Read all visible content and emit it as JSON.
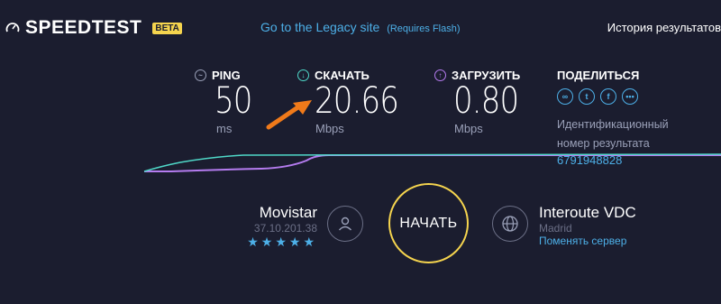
{
  "header": {
    "logo_text": "SPEEDTEST",
    "beta_badge": "BETA",
    "legacy_link": "Go to the Legacy site",
    "legacy_note": "(Requires Flash)",
    "history_link": "История результатов"
  },
  "metrics": {
    "ping": {
      "label": "PING",
      "value": "50",
      "unit": "ms"
    },
    "download": {
      "label": "СКАЧАТЬ",
      "value": "20.66",
      "unit": "Mbps"
    },
    "upload": {
      "label": "ЗАГРУЗИТЬ",
      "value": "0.80",
      "unit": "Mbps"
    }
  },
  "share": {
    "label": "ПОДЕЛИТЬСЯ",
    "result_label_line1": "Идентификационный",
    "result_label_line2": "номер результата",
    "result_id": "6791948828"
  },
  "isp": {
    "name": "Movistar",
    "ip": "37.10.201.38",
    "stars": "★★★★★",
    "rating": 5
  },
  "go_button": {
    "label": "НАЧАТЬ"
  },
  "server": {
    "name": "Interoute VDC",
    "city": "Madrid",
    "change_link": "Поменять сервер"
  },
  "colors": {
    "background": "#1b1d2f",
    "accent_blue": "#4db0e8",
    "download_cyan": "#4fd8c8",
    "upload_purple": "#b57cf0",
    "go_yellow": "#f5d44e",
    "arrow_orange": "#f07a1a"
  },
  "icons": {
    "logo": "speedometer-icon",
    "ping": "ping-icon",
    "download": "download-arrow-icon",
    "upload": "upload-arrow-icon",
    "share": [
      "link-icon",
      "twitter-icon",
      "facebook-icon",
      "more-icon"
    ],
    "user": "user-icon",
    "globe": "globe-icon"
  }
}
